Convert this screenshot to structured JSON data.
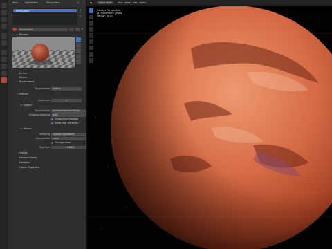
{
  "app": "Blender",
  "properties": {
    "breadcrumb": [
      "Mars",
      "SphereMars",
      "MarsSurface"
    ],
    "material_slot": "MarsSurface",
    "material_name": "MarsSurface",
    "sections": {
      "preview": "Preview",
      "surface": "Surface",
      "volume": "Volume",
      "displacement": "Displacement",
      "settings": "Settings",
      "line_art": "Line Art",
      "viewport_display": "Viewport Display",
      "animation": "Animation",
      "custom_properties": "Custom Properties"
    },
    "displacement": {
      "label": "Displacement",
      "value": "Default"
    },
    "settings": {
      "pass_index_label": "Pass Index",
      "pass_index": "0",
      "surface_label": "Surface",
      "displacement_label": "Displacement",
      "displacement_value": "Displacement and Bump",
      "emission_sampling_label": "Emission Sampling",
      "emission_sampling_value": "Auto",
      "transparent_shadows": "Transparent Shadows",
      "bump_map_correction": "Bump Map Correction",
      "volume_label": "Volume",
      "sampling_label": "Sampling",
      "sampling_value": "Multiple Importance",
      "interpolation_label": "Interpolation",
      "interpolation_value": "Linear",
      "homogeneous": "Homogeneous",
      "step_rate_label": "Step Rate",
      "step_rate_value": "1.0000"
    }
  },
  "viewport": {
    "mode": "Object Mode",
    "menus": [
      "View",
      "Select",
      "Add",
      "Object"
    ],
    "overlay_lines": [
      "Camera Perspective",
      "(1) PlanetMars | Mars",
      "Sensor: 36.00"
    ]
  },
  "colors": {
    "accent": "#4772b3",
    "panel": "#2e2e2e",
    "viewport_bg": "#020202",
    "mars_light": "#e8845a",
    "mars_dark": "#7a2816"
  }
}
